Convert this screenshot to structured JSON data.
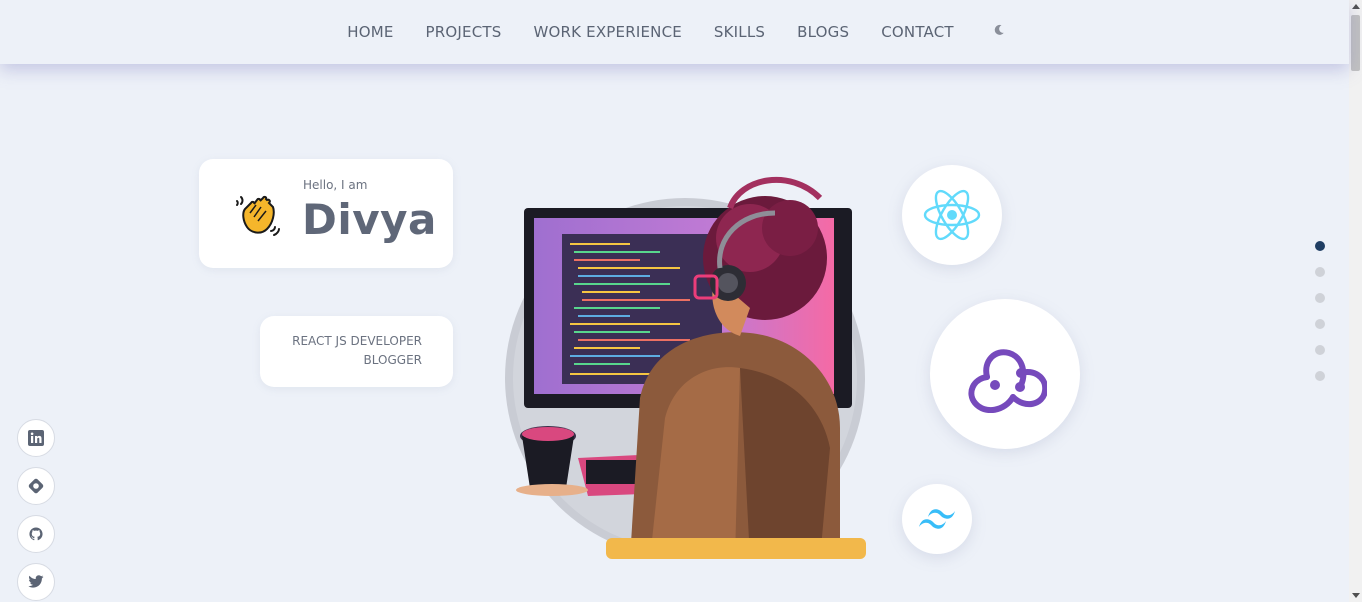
{
  "nav": {
    "items": [
      {
        "label": "HOME"
      },
      {
        "label": "PROJECTS"
      },
      {
        "label": "WORK EXPERIENCE"
      },
      {
        "label": "SKILLS"
      },
      {
        "label": "BLOGS"
      },
      {
        "label": "CONTACT"
      }
    ],
    "theme_icon": "moon-icon"
  },
  "hero": {
    "greeting": "Hello, I am",
    "name": "Divya",
    "roles": [
      "REACT JS DEVELOPER",
      "BLOGGER"
    ]
  },
  "tech_icons": [
    "react-icon",
    "redux-icon",
    "tailwind-icon"
  ],
  "social_icons": [
    "linkedin-icon",
    "hashnode-icon",
    "github-icon",
    "twitter-icon"
  ],
  "section_dots": {
    "count": 6,
    "active_index": 0
  },
  "colors": {
    "background": "#edf1f8",
    "react": "#61dafb",
    "redux": "#764abc",
    "tailwind": "#38bdf8",
    "active_dot": "#1f3e63"
  }
}
